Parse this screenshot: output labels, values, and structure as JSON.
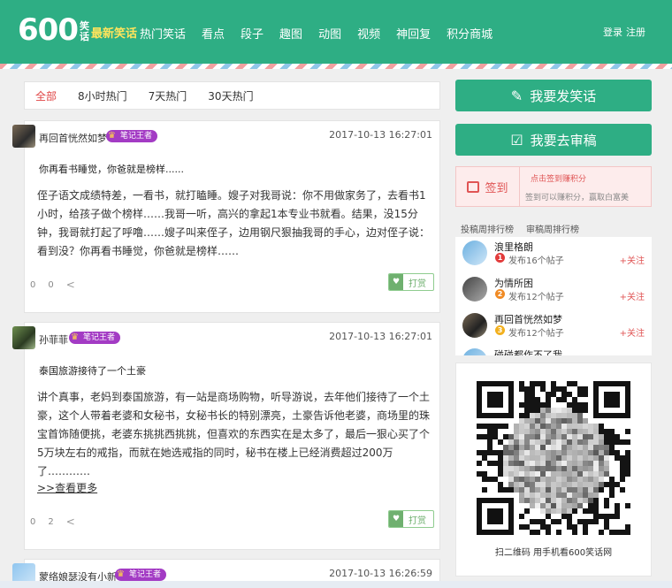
{
  "header": {
    "logo_number": "600",
    "logo_sub_top": "笑",
    "logo_sub_bottom": "话",
    "logo_tagline": "最新笑话",
    "nav": [
      "热门笑话",
      "看点",
      "段子",
      "趣图",
      "动图",
      "视频",
      "神回复",
      "积分商城"
    ],
    "login": "登录",
    "register": "注册"
  },
  "filter_tabs": [
    "全部",
    "8小时热门",
    "7天热门",
    "30天热门"
  ],
  "posts": [
    {
      "author": "再回首恍然如梦",
      "badge": "笔记王者",
      "time": "2017-10-13 16:27:01",
      "title": "你再看书睡觉，你爸就是榜样......",
      "body": "侄子语文成绩特差，一看书，就打瞌睡。嫂子对我哥说：你不用做家务了，去看书1小时，给孩子做个榜样……我哥一听，高兴的拿起1本专业书就看。结果，没15分钟，我哥就打起了呼噜……嫂子叫来侄子，边用钢尺狠抽我哥的手心，边对侄子说：看到没？你再看书睡觉，你爸就是榜样……",
      "more": "",
      "likes": "0",
      "dislikes": "0",
      "tip": "打赏"
    },
    {
      "author": "孙菲菲",
      "badge": "笔记王者",
      "time": "2017-10-13 16:27:01",
      "title": "泰国旅游接待了一个土豪",
      "body": "讲个真事，老妈到泰国旅游，有一站是商场购物，听导游说，去年他们接待了一个土豪，这个人带着老婆和女秘书，女秘书长的特别漂亮，土豪告诉他老婆，商场里的珠宝首饰随便挑，老婆东挑挑西挑挑，但喜欢的东西实在是太多了，最后一狠心买了个5万块左右的戒指，而就在她选戒指的同时，秘书在楼上已经消费超过200万了…………",
      "more": ">>查看更多",
      "likes": "0",
      "dislikes": "2",
      "tip": "打赏"
    },
    {
      "author": "蒙络娘瑟没有小新",
      "badge": "笔记王者",
      "time": "2017-10-13 16:26:59",
      "title": "",
      "body": "",
      "more": "",
      "likes": "",
      "dislikes": "",
      "tip": ""
    }
  ],
  "sidebar": {
    "post_joke": "我要发笑话",
    "review": "我要去审稿",
    "signin_label": "签到",
    "signin_line1": "点击签到赚积分",
    "signin_line2": "签到可以赚积分，赢取白富美",
    "rank_tabs": [
      "投稿周排行榜",
      "审稿周排行榜"
    ],
    "rank": [
      {
        "name": "浪里格朗",
        "medal": "1",
        "medal_color": "#e23b3b",
        "count": "发布16个帖子",
        "follow": "+关注"
      },
      {
        "name": "为情所困",
        "medal": "2",
        "medal_color": "#f08a24",
        "count": "发布12个帖子",
        "follow": "+关注"
      },
      {
        "name": "再回首恍然如梦",
        "medal": "3",
        "medal_color": "#f2b01e",
        "count": "发布12个帖子",
        "follow": "+关注"
      },
      {
        "name": "碰碰都作不了我",
        "medal": "",
        "medal_color": "#999999",
        "count": "",
        "follow": ""
      }
    ],
    "qr_caption": "扫二维码 用手机看600笑话网"
  },
  "colors": {
    "brand": "#2eae84",
    "badge": "#a33bc4",
    "accent_red": "#e04545"
  }
}
